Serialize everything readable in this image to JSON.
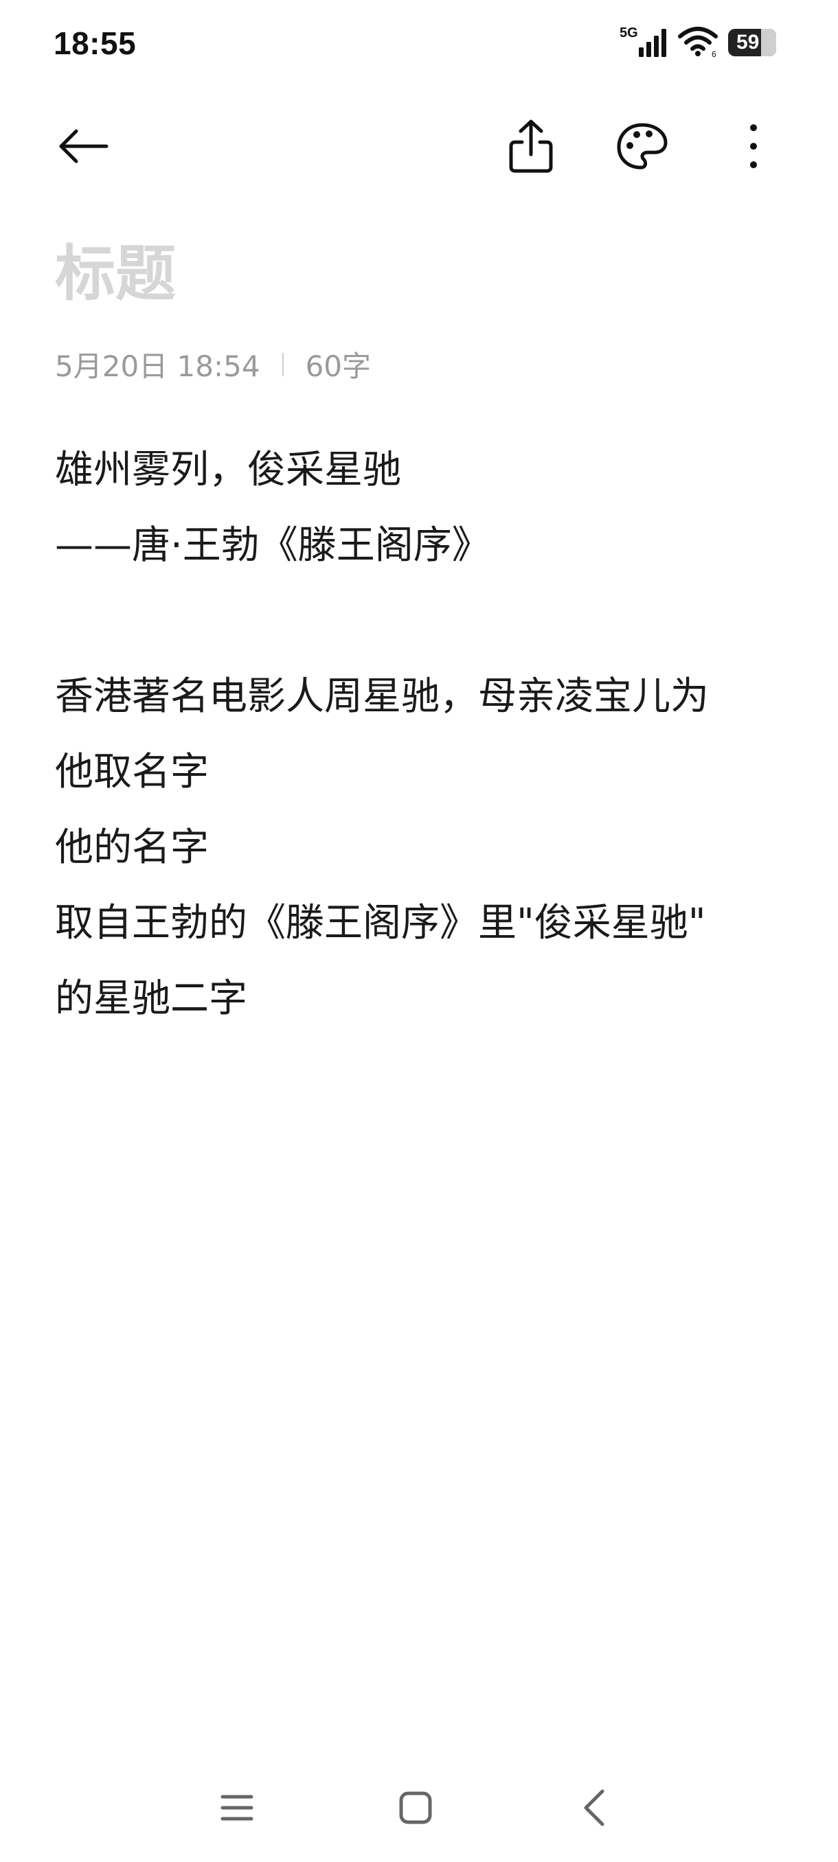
{
  "status_bar": {
    "time": "18:55",
    "network": "5G",
    "battery": "59",
    "icons": [
      "signal-icon",
      "wifi-icon",
      "battery-icon"
    ]
  },
  "toolbar": {
    "icons": [
      "back-arrow-icon",
      "share-icon",
      "palette-icon",
      "more-vertical-icon"
    ]
  },
  "note": {
    "title_placeholder": "标题",
    "date": "5月20日 18:54",
    "char_count": "60字",
    "lines": [
      "雄州雾列，俊采星驰",
      "——唐·王勃《滕王阁序》",
      "",
      "香港著名电影人周星驰，母亲凌宝儿为",
      "他取名字",
      "他的名字",
      "取自王勃的《滕王阁序》里\"俊采星驰\"",
      "的星驰二字"
    ]
  },
  "nav_bar": {
    "icons": [
      "menu-icon",
      "home-icon",
      "back-icon"
    ]
  }
}
